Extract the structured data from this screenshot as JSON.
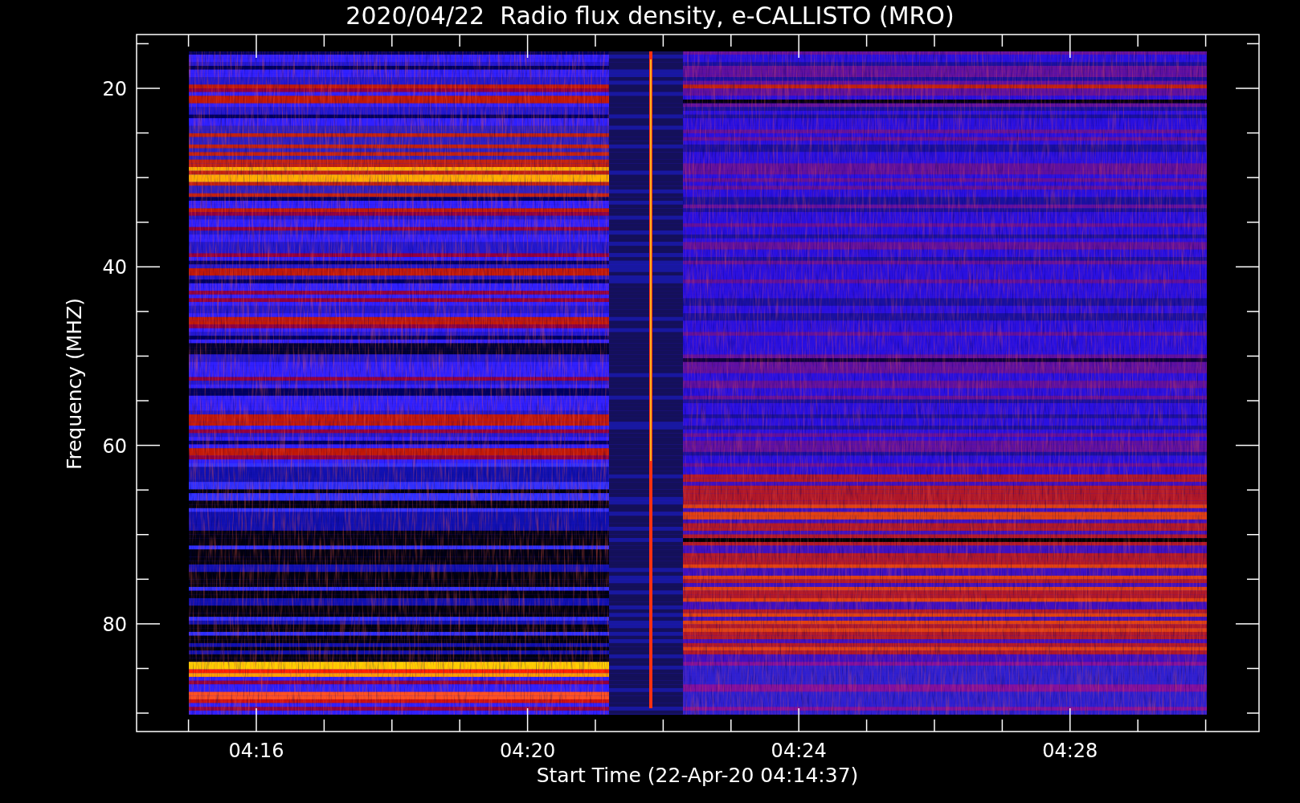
{
  "title": "2020/04/22  Radio flux density, e-CALLISTO (MRO)",
  "plot": {
    "ylabel": "Frequency (MHZ)",
    "xlabel": "Start Time (22-Apr-20 04:14:37)",
    "yticks": [
      "20",
      "40",
      "60",
      "80"
    ],
    "xticks": [
      "04:16",
      "04:20",
      "04:24",
      "04:28"
    ]
  }
}
